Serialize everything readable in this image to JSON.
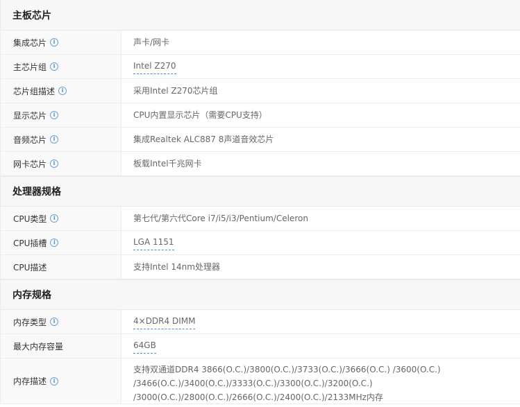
{
  "sections": [
    {
      "title": "主板芯片",
      "rows": [
        {
          "label": "集成芯片",
          "value": "声卡/网卡"
        },
        {
          "label": "主芯片组",
          "value": "Intel Z270"
        },
        {
          "label": "芯片组描述",
          "value": "采用Intel Z270芯片组"
        },
        {
          "label": "显示芯片",
          "value": "CPU内置显示芯片（需要CPU支持）"
        },
        {
          "label": "音频芯片",
          "value": "集成Realtek ALC887 8声道音效芯片"
        },
        {
          "label": "网卡芯片",
          "value": "板载Intel千兆网卡"
        }
      ]
    },
    {
      "title": "处理器规格",
      "rows": [
        {
          "label": "CPU类型",
          "value": "第七代/第六代Core i7/i5/i3/Pentium/Celeron"
        },
        {
          "label": "CPU插槽",
          "value": "LGA 1151"
        },
        {
          "label": "CPU描述",
          "value": "支持Intel 14nm处理器"
        }
      ]
    },
    {
      "title": "内存规格",
      "rows": [
        {
          "label": "内存类型",
          "value": "4×DDR4 DIMM"
        },
        {
          "label": "最大内存容量",
          "value": "64GB"
        },
        {
          "label": "内存描述",
          "value": "支持双通道DDR4 3866(O.C.)/3800(O.C.)/3733(O.C.)/3666(O.C.) /3600(O.C.) /3466(O.C.)/3400(O.C.)/3333(O.C.)/3300(O.C.)/3200(O.C.) /3000(O.C.)/2800(O.C.)/2666(O.C.)/2400(O.C.)/2133MHz内存"
        }
      ]
    }
  ],
  "info_icon_glyph": "i",
  "accent_color": "#4a8ad8"
}
